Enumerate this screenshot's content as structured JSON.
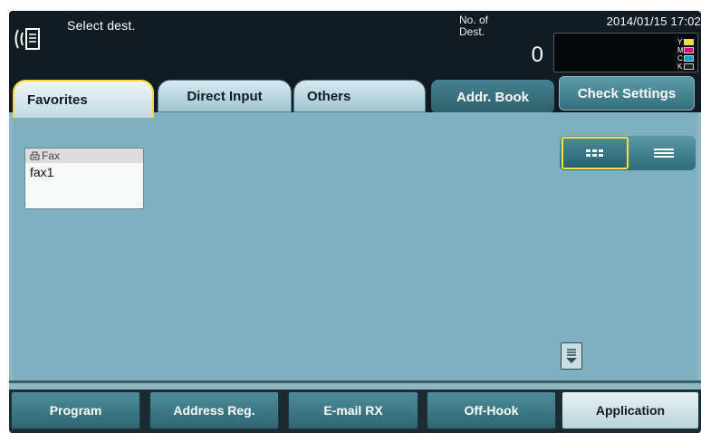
{
  "header": {
    "title": "Select dest.",
    "dest_label_line1": "No. of",
    "dest_label_line2": "Dest.",
    "dest_count": "0",
    "datetime": "2014/01/15 17:02",
    "toner": [
      {
        "label": "Y",
        "color": "#f5e500"
      },
      {
        "label": "M",
        "color": "#e2007a"
      },
      {
        "label": "C",
        "color": "#00a0e9"
      },
      {
        "label": "K",
        "color": "#222222"
      }
    ]
  },
  "tabs": [
    {
      "label": "Favorites",
      "active": true
    },
    {
      "label": "Direct Input"
    },
    {
      "label": "Others"
    },
    {
      "label": "Addr. Book"
    }
  ],
  "check_settings_label": "Check Settings",
  "destinations": [
    {
      "type": "Fax",
      "name": "fax1"
    }
  ],
  "bottom_bar": [
    {
      "label": "Program"
    },
    {
      "label": "Address Reg."
    },
    {
      "label": "E-mail RX"
    },
    {
      "label": "Off-Hook"
    },
    {
      "label": "Application"
    }
  ],
  "colors": {
    "accent_highlight": "#f2dd2b",
    "panel_background": "#7eb0bf"
  }
}
